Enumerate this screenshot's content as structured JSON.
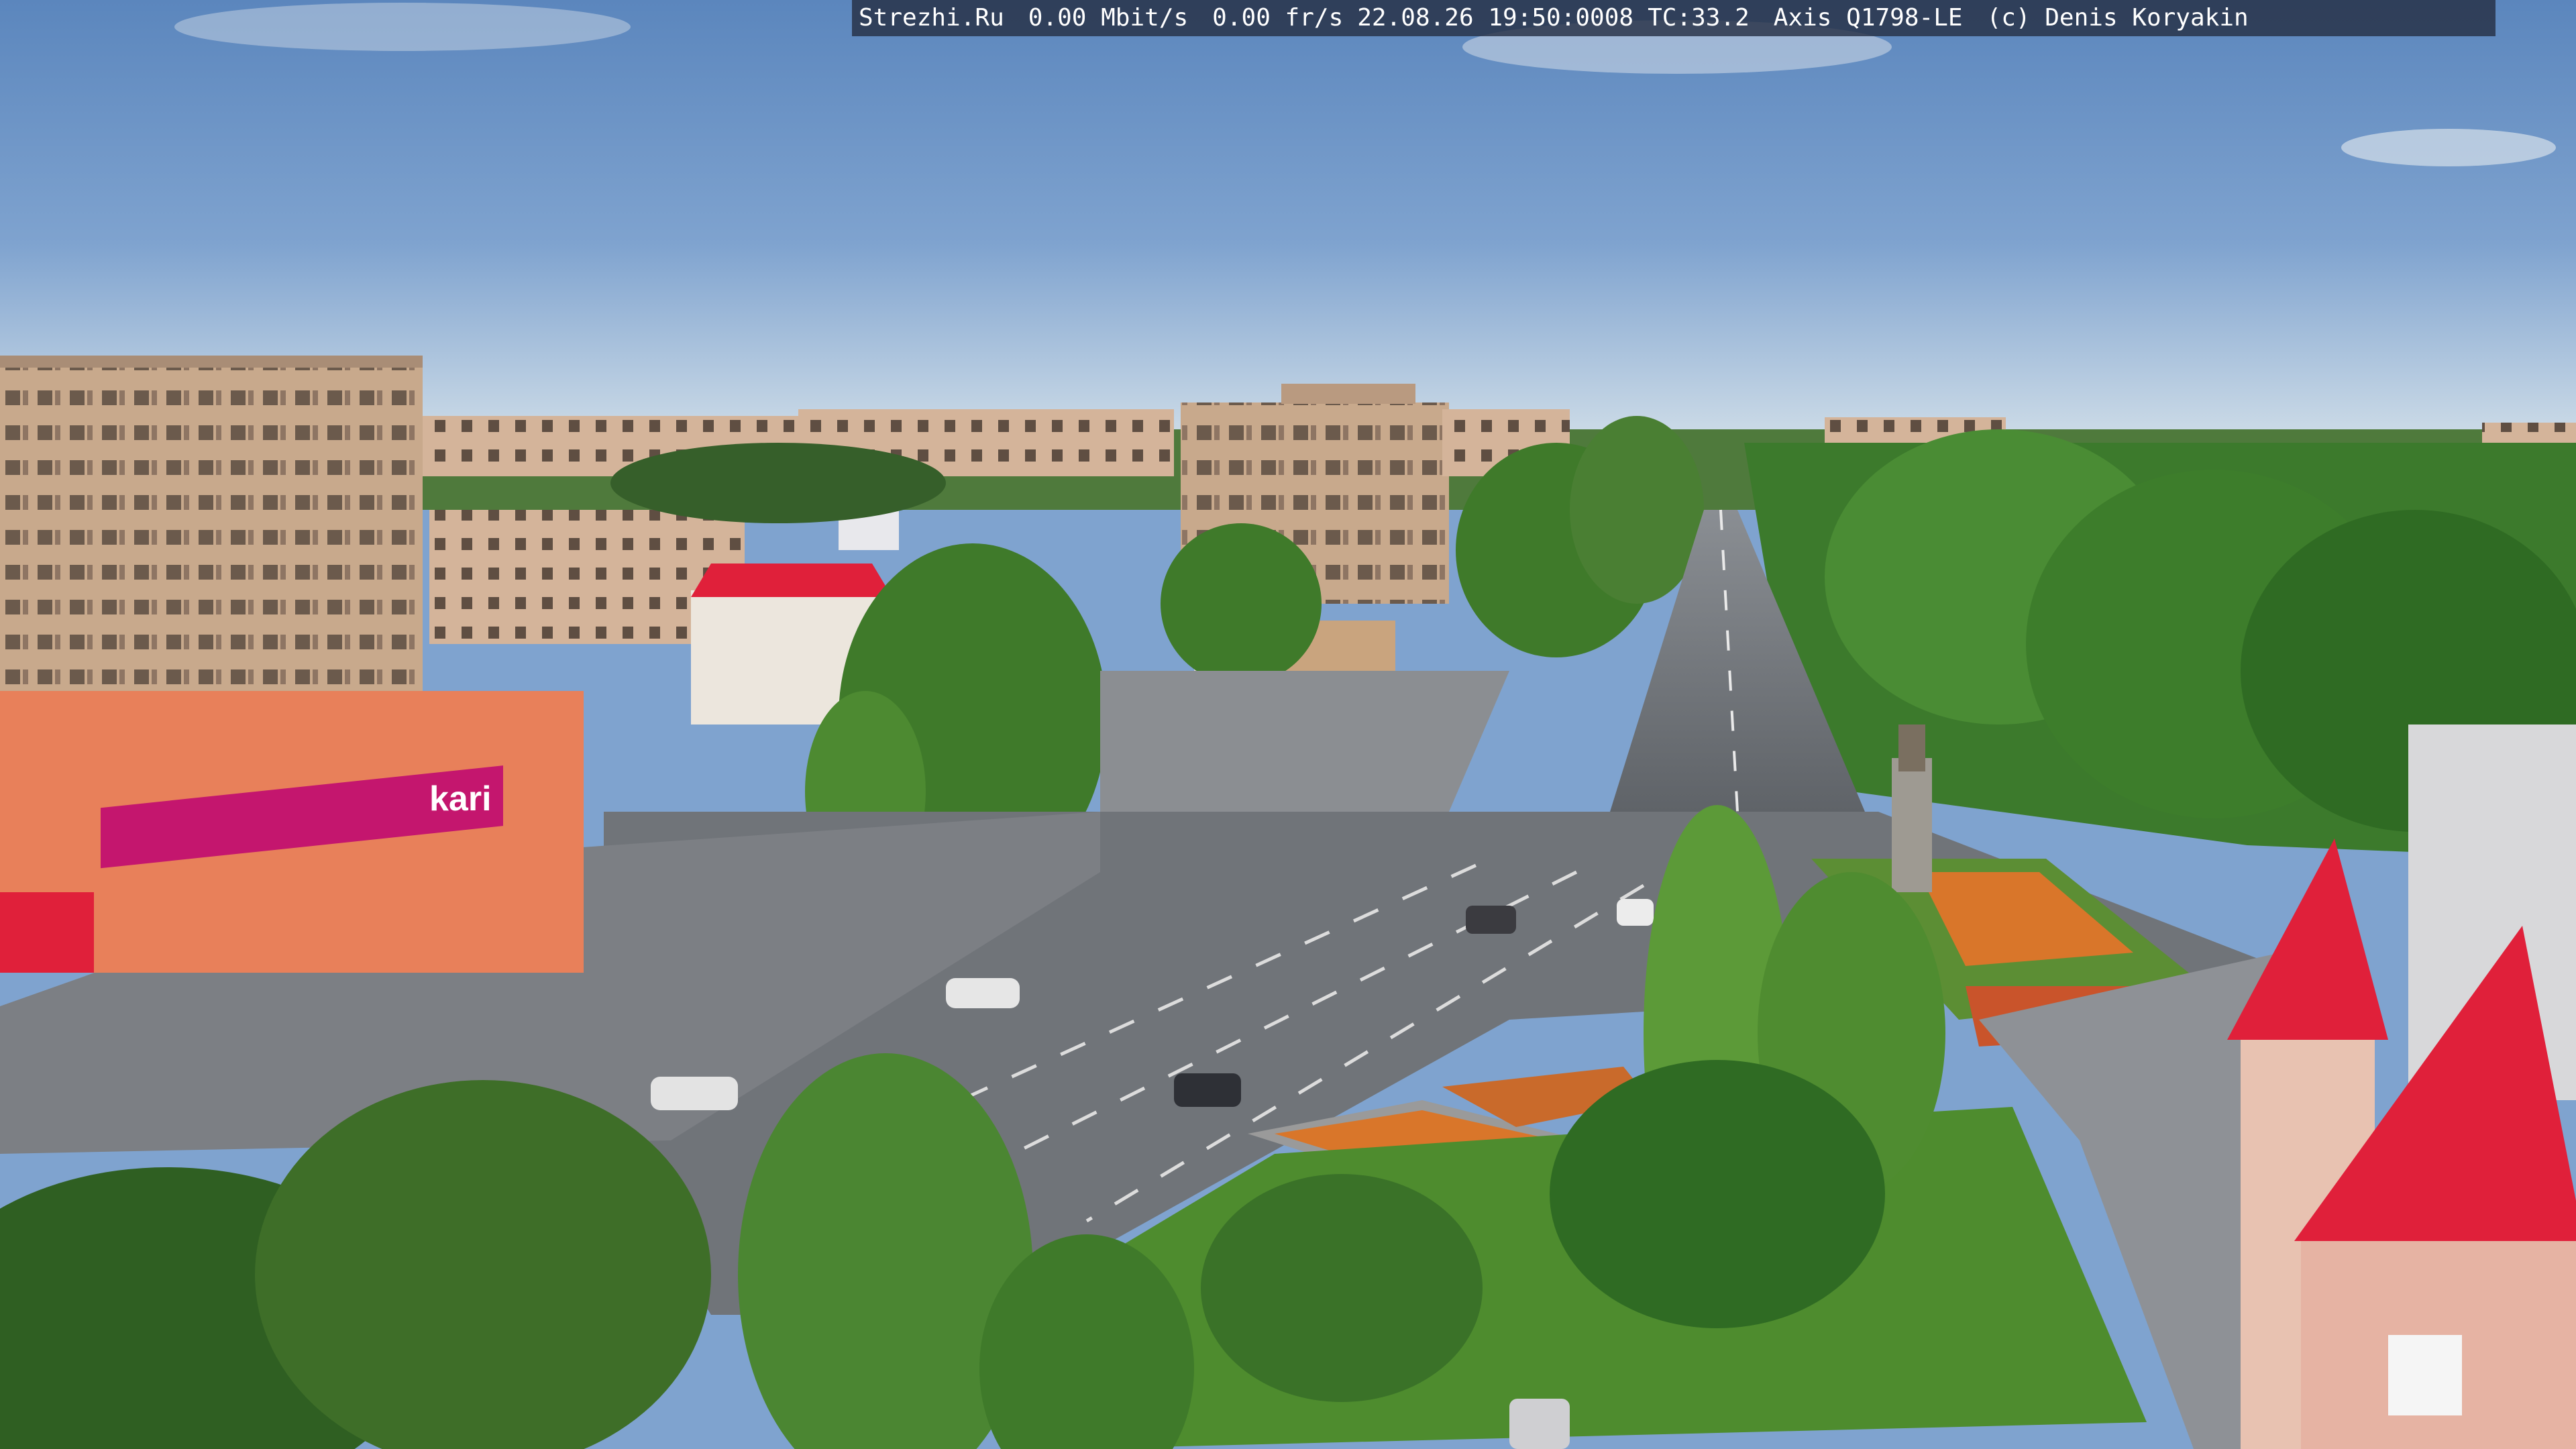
{
  "overlay": {
    "site": "Strezhi.Ru",
    "bitrate": "0.00 Mbit/s",
    "framerate": "0.00 fr/s",
    "datetime": "22.08.26 19:50:0008",
    "tc": "TC:33.2",
    "camera": "Axis Q1798-LE",
    "copyright": "(c) Denis Koryakin"
  },
  "signs": {
    "store_brand": "kari"
  },
  "colors": {
    "sky_top": "#5b86bd",
    "sky_horizon": "#cfdde8",
    "trees": "#3f7a2a",
    "asphalt": "#6e7277",
    "plaza": "#7d8085",
    "building_beige": "#c9a98d",
    "roof_red": "#e0203a",
    "storefront_magenta": "#c4166e",
    "storefront_orange": "#e8805a",
    "grass": "#4e8c2e",
    "flowers": "#d9762a"
  }
}
